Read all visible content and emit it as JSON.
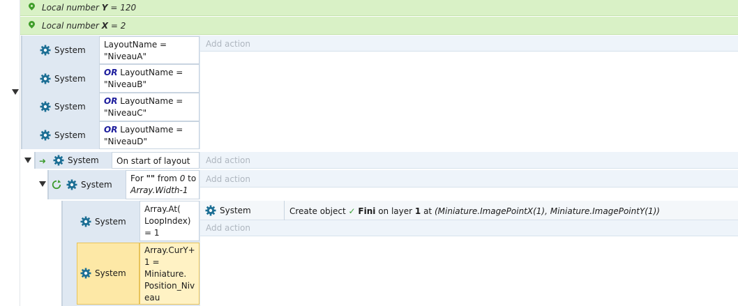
{
  "variables": [
    {
      "label": "Local number",
      "name": "Y",
      "value": "= 120"
    },
    {
      "label": "Local number",
      "name": "X",
      "value": "= 2"
    }
  ],
  "system_label": "System",
  "add_action": "Add action",
  "event1": {
    "conditions": [
      {
        "prefix": "",
        "line1": "LayoutName =",
        "line2": "\"NiveauA\""
      },
      {
        "prefix": "OR",
        "line1": " LayoutName =",
        "line2": "\"NiveauB\""
      },
      {
        "prefix": "OR",
        "line1": " LayoutName =",
        "line2": "\"NiveauC\""
      },
      {
        "prefix": "OR",
        "line1": " LayoutName =",
        "line2": "\"NiveauD\""
      }
    ]
  },
  "event2": {
    "condition": "On start of layout"
  },
  "event3": {
    "for_word": "For",
    "quote": "\"\"",
    "from": "from",
    "start": "0",
    "to": "to",
    "end": "Array.Width-1"
  },
  "event4": {
    "condition_lines": [
      "Array.At(",
      "LoopIndex)",
      "= 1"
    ],
    "action": {
      "text_create": "Create object",
      "object": "Fini",
      "on_layer": "on layer",
      "layer": "1",
      "at": "at",
      "coords": "(Miniature.ImagePointX(1), Miniature.ImagePointY(1))"
    },
    "selected_condition_lines": [
      "Array.CurY+",
      "1 =",
      "Miniature.",
      "Position_Niv",
      "eau"
    ]
  }
}
